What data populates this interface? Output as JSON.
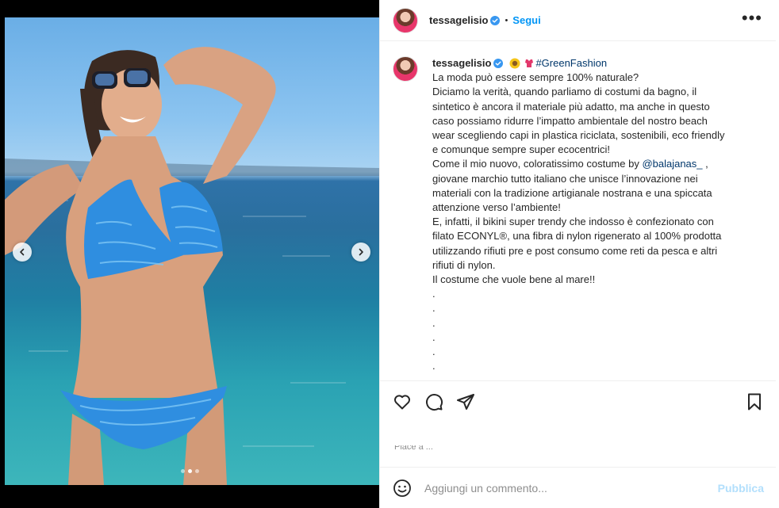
{
  "post": {
    "username": "tessagelisio",
    "separator": "•",
    "follow_label": "Segui",
    "more_label": "•••",
    "image_alt": "tessagelisio in costume da bagno blu al mare"
  },
  "carousel": {
    "slide_count": 3,
    "active_index": 1
  },
  "caption": {
    "username": "tessagelisio",
    "hashtag": "#GreenFashion",
    "lines": [
      "La moda può essere sempre 100% naturale?",
      "Diciamo la verità, quando parliamo di costumi da bagno, il",
      "sintetico è ancora il materiale più adatto, ma anche in questo",
      "caso possiamo ridurre l’impatto ambientale del nostro beach",
      "wear scegliendo capi in plastica riciclata, sostenibili, eco friendly",
      "e comunque sempre super ecocentrici!"
    ],
    "line_mention_prefix": "Come il mio nuovo, coloratissimo costume by ",
    "mention": "@balajanas_",
    "line_mention_suffix": " ,",
    "lines_after": [
      "giovane marchio tutto italiano che unisce l’innovazione nei",
      "materiali con la tradizione artigianale nostrana e una spiccata",
      "attenzione verso l’ambiente!",
      "E, infatti, il bikini super trendy che indosso è confezionato con",
      "filato ECONYL®, una fibra di nylon rigenerato al 100% prodotta",
      "utilizzando rifiuti pre e post consumo come reti da pesca e altri",
      "rifiuti di nylon.",
      "Il costume che vuole bene al mare!!",
      ".",
      ".",
      ".",
      ".",
      ".",
      "."
    ]
  },
  "actions": {
    "like": "heart-icon",
    "comment": "comment-icon",
    "share": "send-icon",
    "save": "bookmark-icon",
    "likes_text": "Piace a ..."
  },
  "comment_bar": {
    "placeholder": "Aggiungi un commento...",
    "publish_label": "Pubblica"
  },
  "colors": {
    "accent": "#0095f6",
    "link": "#00376b",
    "publish_disabled": "#b2dffc",
    "verified": "#3897f0"
  }
}
